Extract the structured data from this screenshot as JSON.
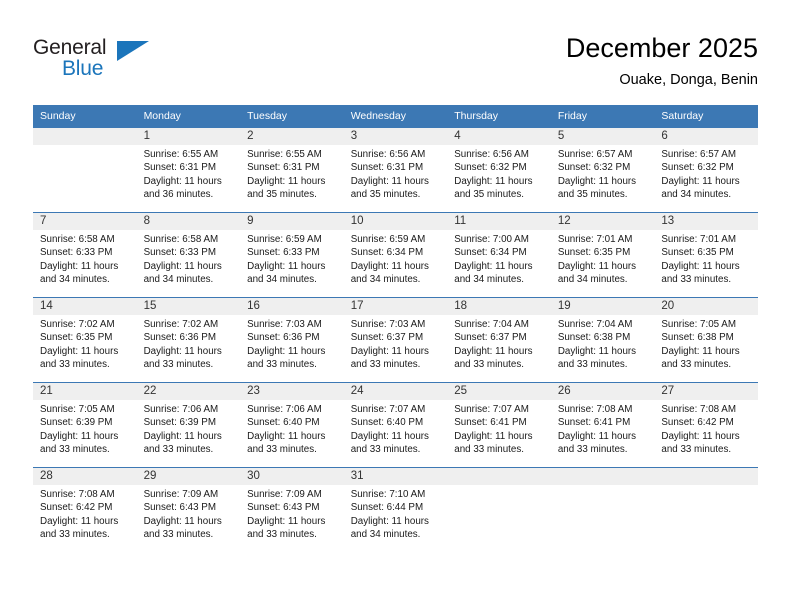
{
  "logo": {
    "word1": "General",
    "word2": "Blue",
    "triangle_color": "#1b75bb",
    "word1_color": "#231f20",
    "word2_color": "#1b75bb"
  },
  "header": {
    "title": "December 2025",
    "subtitle": "Ouake, Donga, Benin"
  },
  "theme": {
    "header_band": "#3c78b4",
    "daynum_band": "#efefef",
    "grid_line": "#3c78b4"
  },
  "weekday_headers": [
    "Sunday",
    "Monday",
    "Tuesday",
    "Wednesday",
    "Thursday",
    "Friday",
    "Saturday"
  ],
  "weeks": [
    [
      {
        "day": "",
        "blank": true,
        "lines": []
      },
      {
        "day": "1",
        "lines": [
          "Sunrise: 6:55 AM",
          "Sunset: 6:31 PM",
          "Daylight: 11 hours",
          "and 36 minutes."
        ]
      },
      {
        "day": "2",
        "lines": [
          "Sunrise: 6:55 AM",
          "Sunset: 6:31 PM",
          "Daylight: 11 hours",
          "and 35 minutes."
        ]
      },
      {
        "day": "3",
        "lines": [
          "Sunrise: 6:56 AM",
          "Sunset: 6:31 PM",
          "Daylight: 11 hours",
          "and 35 minutes."
        ]
      },
      {
        "day": "4",
        "lines": [
          "Sunrise: 6:56 AM",
          "Sunset: 6:32 PM",
          "Daylight: 11 hours",
          "and 35 minutes."
        ]
      },
      {
        "day": "5",
        "lines": [
          "Sunrise: 6:57 AM",
          "Sunset: 6:32 PM",
          "Daylight: 11 hours",
          "and 35 minutes."
        ]
      },
      {
        "day": "6",
        "lines": [
          "Sunrise: 6:57 AM",
          "Sunset: 6:32 PM",
          "Daylight: 11 hours",
          "and 34 minutes."
        ]
      }
    ],
    [
      {
        "day": "7",
        "lines": [
          "Sunrise: 6:58 AM",
          "Sunset: 6:33 PM",
          "Daylight: 11 hours",
          "and 34 minutes."
        ]
      },
      {
        "day": "8",
        "lines": [
          "Sunrise: 6:58 AM",
          "Sunset: 6:33 PM",
          "Daylight: 11 hours",
          "and 34 minutes."
        ]
      },
      {
        "day": "9",
        "lines": [
          "Sunrise: 6:59 AM",
          "Sunset: 6:33 PM",
          "Daylight: 11 hours",
          "and 34 minutes."
        ]
      },
      {
        "day": "10",
        "lines": [
          "Sunrise: 6:59 AM",
          "Sunset: 6:34 PM",
          "Daylight: 11 hours",
          "and 34 minutes."
        ]
      },
      {
        "day": "11",
        "lines": [
          "Sunrise: 7:00 AM",
          "Sunset: 6:34 PM",
          "Daylight: 11 hours",
          "and 34 minutes."
        ]
      },
      {
        "day": "12",
        "lines": [
          "Sunrise: 7:01 AM",
          "Sunset: 6:35 PM",
          "Daylight: 11 hours",
          "and 34 minutes."
        ]
      },
      {
        "day": "13",
        "lines": [
          "Sunrise: 7:01 AM",
          "Sunset: 6:35 PM",
          "Daylight: 11 hours",
          "and 33 minutes."
        ]
      }
    ],
    [
      {
        "day": "14",
        "lines": [
          "Sunrise: 7:02 AM",
          "Sunset: 6:35 PM",
          "Daylight: 11 hours",
          "and 33 minutes."
        ]
      },
      {
        "day": "15",
        "lines": [
          "Sunrise: 7:02 AM",
          "Sunset: 6:36 PM",
          "Daylight: 11 hours",
          "and 33 minutes."
        ]
      },
      {
        "day": "16",
        "lines": [
          "Sunrise: 7:03 AM",
          "Sunset: 6:36 PM",
          "Daylight: 11 hours",
          "and 33 minutes."
        ]
      },
      {
        "day": "17",
        "lines": [
          "Sunrise: 7:03 AM",
          "Sunset: 6:37 PM",
          "Daylight: 11 hours",
          "and 33 minutes."
        ]
      },
      {
        "day": "18",
        "lines": [
          "Sunrise: 7:04 AM",
          "Sunset: 6:37 PM",
          "Daylight: 11 hours",
          "and 33 minutes."
        ]
      },
      {
        "day": "19",
        "lines": [
          "Sunrise: 7:04 AM",
          "Sunset: 6:38 PM",
          "Daylight: 11 hours",
          "and 33 minutes."
        ]
      },
      {
        "day": "20",
        "lines": [
          "Sunrise: 7:05 AM",
          "Sunset: 6:38 PM",
          "Daylight: 11 hours",
          "and 33 minutes."
        ]
      }
    ],
    [
      {
        "day": "21",
        "lines": [
          "Sunrise: 7:05 AM",
          "Sunset: 6:39 PM",
          "Daylight: 11 hours",
          "and 33 minutes."
        ]
      },
      {
        "day": "22",
        "lines": [
          "Sunrise: 7:06 AM",
          "Sunset: 6:39 PM",
          "Daylight: 11 hours",
          "and 33 minutes."
        ]
      },
      {
        "day": "23",
        "lines": [
          "Sunrise: 7:06 AM",
          "Sunset: 6:40 PM",
          "Daylight: 11 hours",
          "and 33 minutes."
        ]
      },
      {
        "day": "24",
        "lines": [
          "Sunrise: 7:07 AM",
          "Sunset: 6:40 PM",
          "Daylight: 11 hours",
          "and 33 minutes."
        ]
      },
      {
        "day": "25",
        "lines": [
          "Sunrise: 7:07 AM",
          "Sunset: 6:41 PM",
          "Daylight: 11 hours",
          "and 33 minutes."
        ]
      },
      {
        "day": "26",
        "lines": [
          "Sunrise: 7:08 AM",
          "Sunset: 6:41 PM",
          "Daylight: 11 hours",
          "and 33 minutes."
        ]
      },
      {
        "day": "27",
        "lines": [
          "Sunrise: 7:08 AM",
          "Sunset: 6:42 PM",
          "Daylight: 11 hours",
          "and 33 minutes."
        ]
      }
    ],
    [
      {
        "day": "28",
        "lines": [
          "Sunrise: 7:08 AM",
          "Sunset: 6:42 PM",
          "Daylight: 11 hours",
          "and 33 minutes."
        ]
      },
      {
        "day": "29",
        "lines": [
          "Sunrise: 7:09 AM",
          "Sunset: 6:43 PM",
          "Daylight: 11 hours",
          "and 33 minutes."
        ]
      },
      {
        "day": "30",
        "lines": [
          "Sunrise: 7:09 AM",
          "Sunset: 6:43 PM",
          "Daylight: 11 hours",
          "and 33 minutes."
        ]
      },
      {
        "day": "31",
        "lines": [
          "Sunrise: 7:10 AM",
          "Sunset: 6:44 PM",
          "Daylight: 11 hours",
          "and 34 minutes."
        ]
      },
      {
        "day": "",
        "blank": true,
        "lines": []
      },
      {
        "day": "",
        "blank": true,
        "lines": []
      },
      {
        "day": "",
        "blank": true,
        "lines": []
      }
    ]
  ]
}
